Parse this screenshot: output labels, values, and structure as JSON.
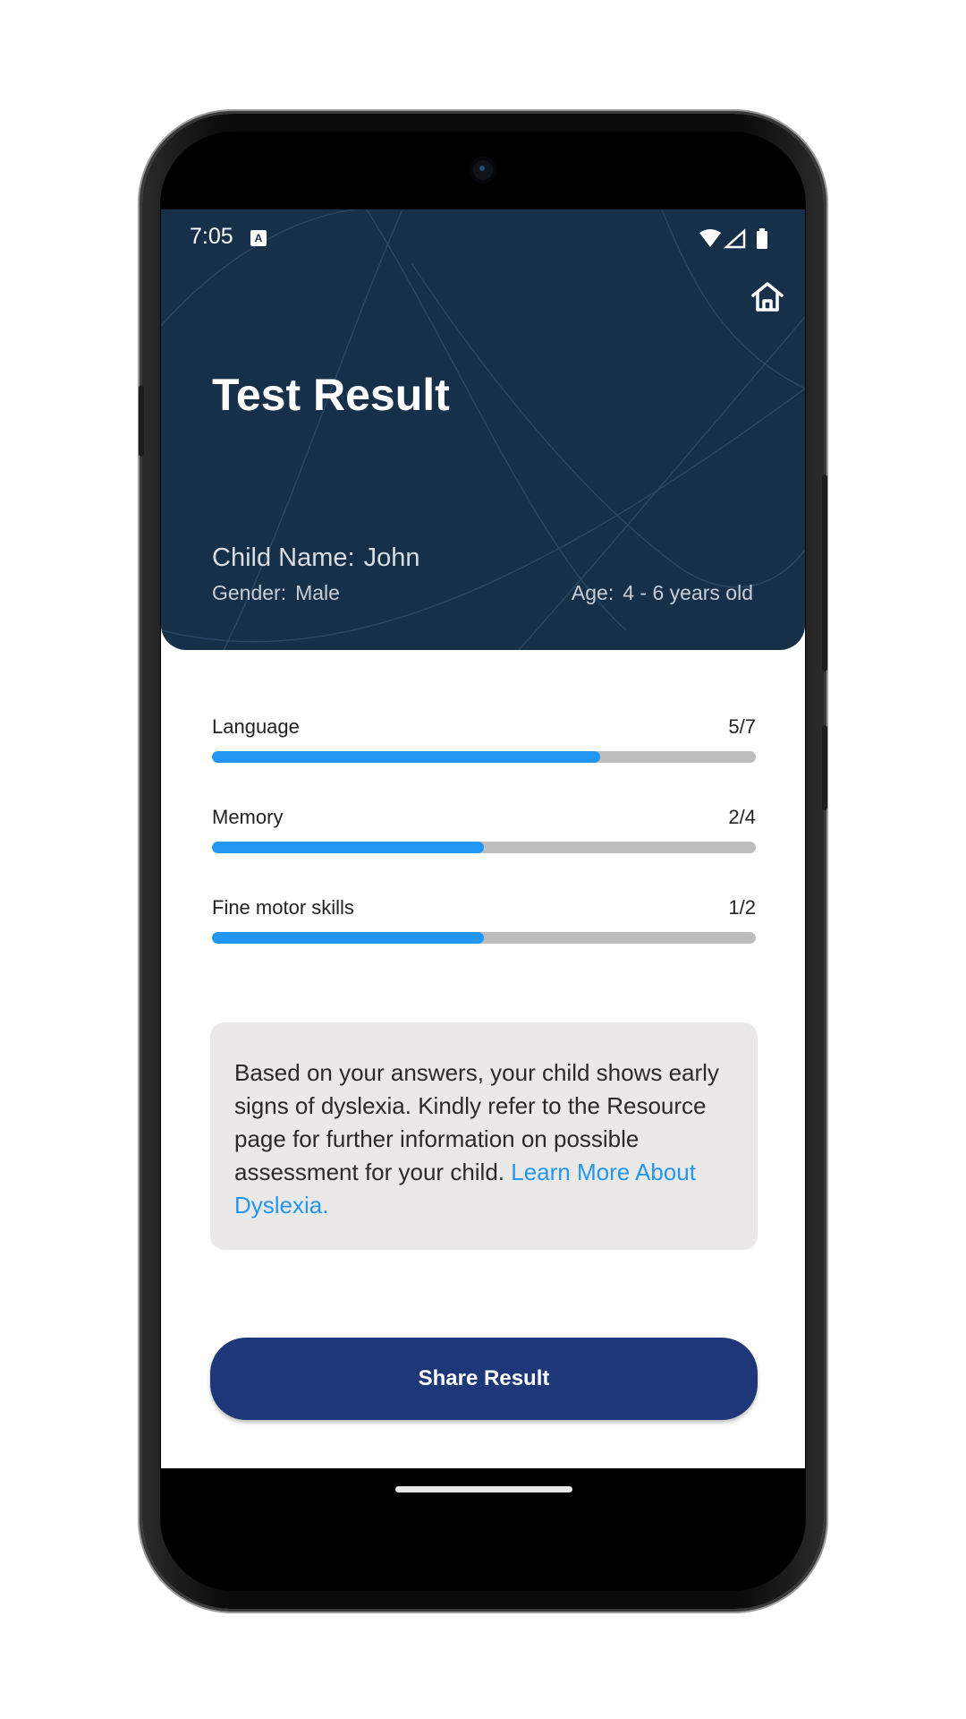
{
  "status_bar": {
    "time": "7:05",
    "notification_icon": "a-badge-icon",
    "icons": [
      "wifi-icon",
      "signal-icon",
      "battery-icon"
    ]
  },
  "header": {
    "title": "Test Result",
    "home_icon": "home-icon",
    "child_name_label": "Child Name:",
    "child_name_value": "John",
    "gender_label": "Gender:",
    "gender_value": "Male",
    "age_label": "Age:",
    "age_value": "4 - 6 years old"
  },
  "skills": [
    {
      "label": "Language",
      "score": "5/7",
      "fraction": 0.714
    },
    {
      "label": "Memory",
      "score": "2/4",
      "fraction": 0.5
    },
    {
      "label": "Fine motor skills",
      "score": "1/2",
      "fraction": 0.5
    }
  ],
  "info": {
    "text": "Based on your answers, your child shows early signs of dyslexia. Kindly refer to the Resource page for further information on possible assessment for your child. ",
    "link": "Learn More About Dyslexia."
  },
  "share_button": {
    "label": "Share Result"
  },
  "colors": {
    "header_bg": "#163049",
    "progress_fill": "#2196f3",
    "progress_track": "#bdbdbd",
    "button_bg": "#1e3778",
    "info_bg": "#ebe9e8",
    "link": "#2196f3"
  }
}
